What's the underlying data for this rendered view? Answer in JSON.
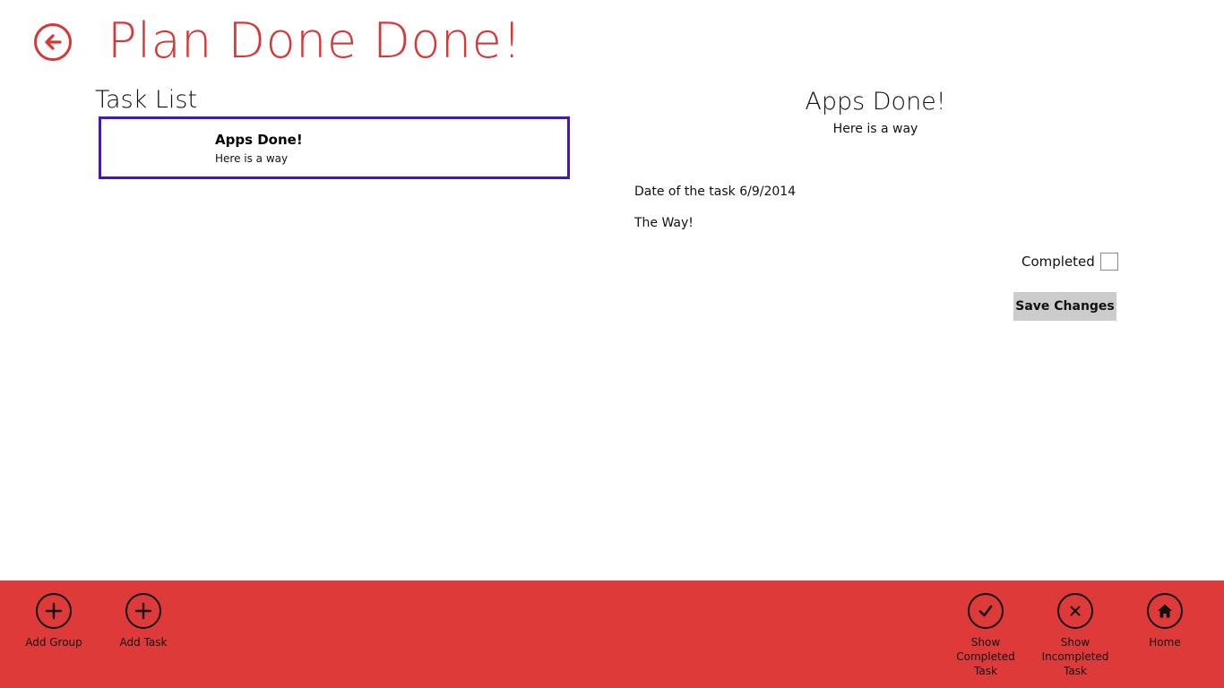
{
  "header": {
    "title": "Plan Done Done!",
    "back_icon": "back-arrow-icon"
  },
  "task_list": {
    "heading": "Task List",
    "items": [
      {
        "title": "Apps Done!",
        "subtitle": "Here is a way"
      }
    ]
  },
  "detail": {
    "title": "Apps Done!",
    "subtitle": "Here is a way",
    "date_text": "Date of the task 6/9/2014",
    "description": "The Way!",
    "completed_label": "Completed",
    "completed_checked": false,
    "save_label": "Save Changes"
  },
  "app_bar": {
    "background": "#de3a3a",
    "left_buttons": [
      {
        "label": "Add Group",
        "icon": "plus-icon"
      },
      {
        "label": "Add Task",
        "icon": "plus-icon"
      }
    ],
    "right_buttons": [
      {
        "label": "Show Completed Task",
        "icon": "checkmark-icon"
      },
      {
        "label": "Show Incompleted Task",
        "icon": "x-icon"
      },
      {
        "label": "Home",
        "icon": "home-icon"
      }
    ]
  },
  "colors": {
    "accent": "#d63838",
    "selection_border": "#4617b4",
    "button_bg": "#cccccc"
  }
}
